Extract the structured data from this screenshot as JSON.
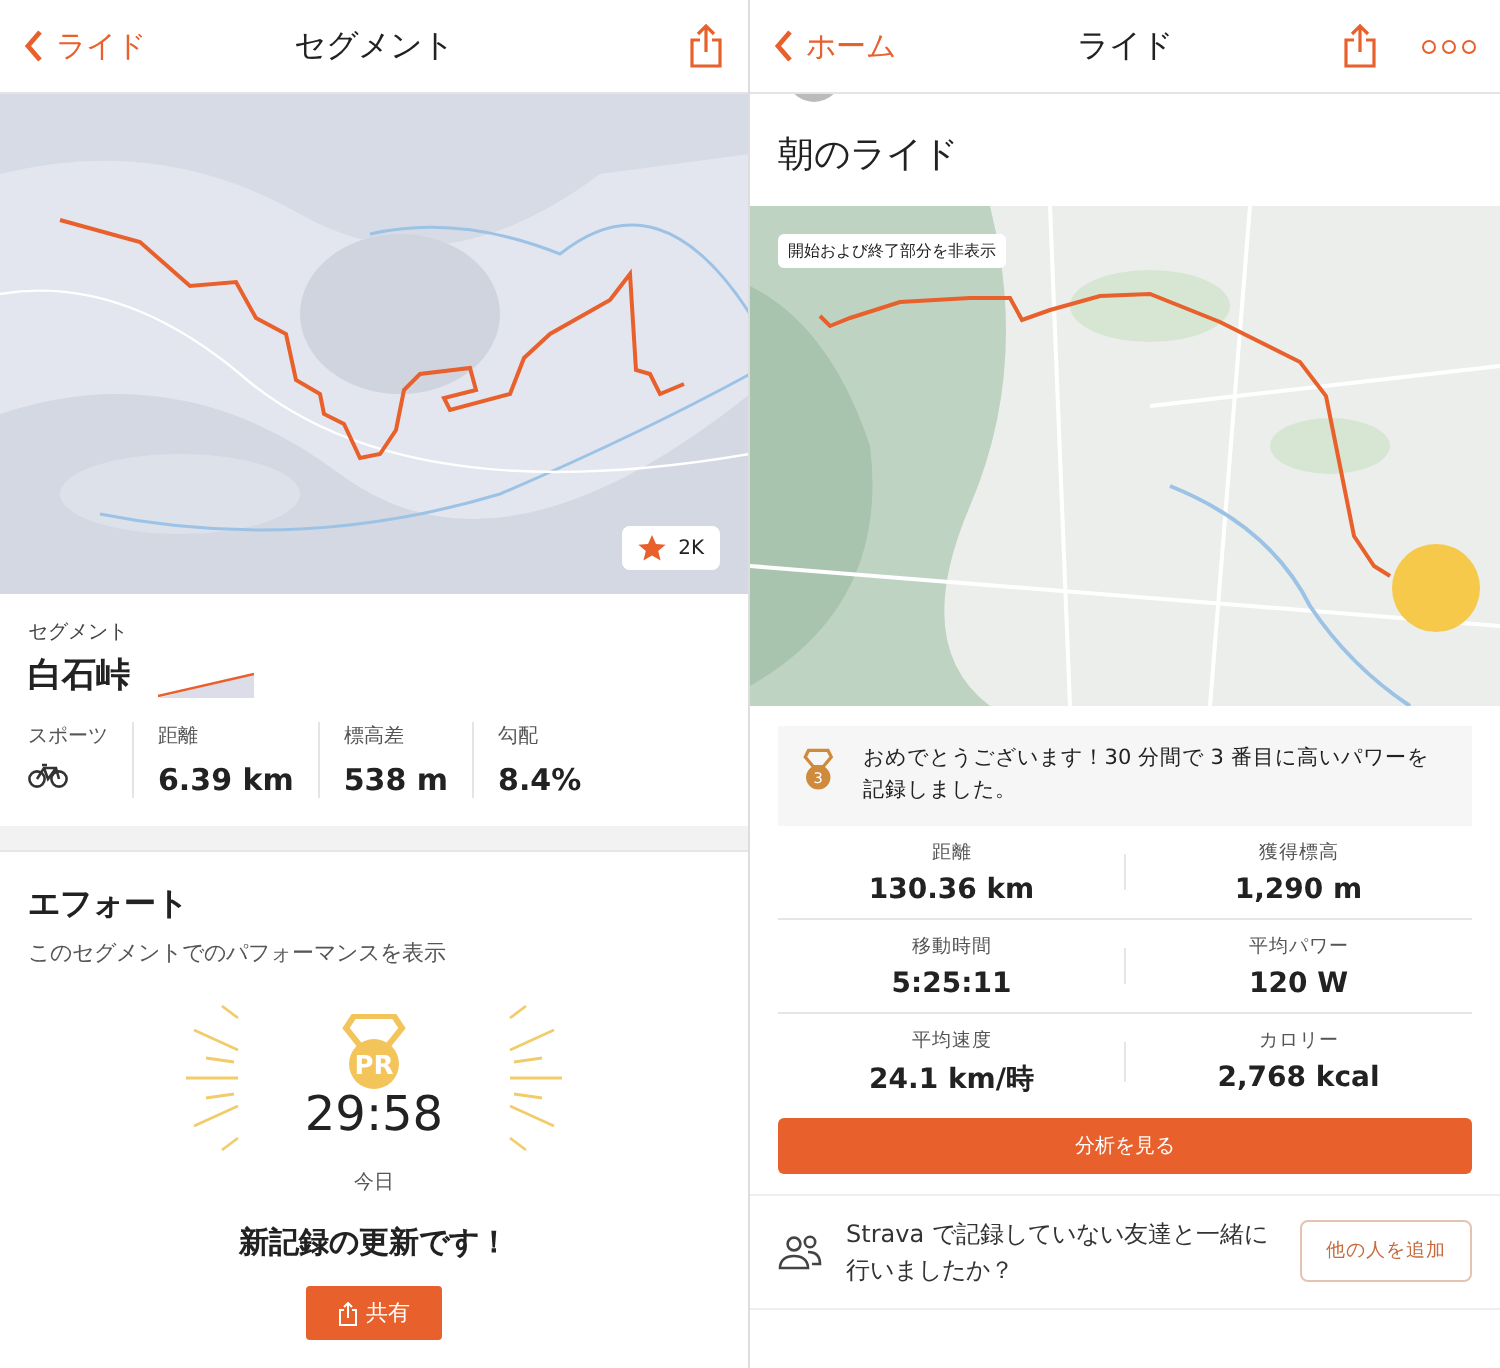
{
  "left": {
    "nav": {
      "back": "ライド",
      "title": "セグメント"
    },
    "map": {
      "kind": "picture",
      "badge": "2K"
    },
    "segment": {
      "label": "セグメント",
      "name": "白石峠"
    },
    "stats": [
      {
        "kind": "sport",
        "label": "スポーツ"
      },
      {
        "kind": "value",
        "label": "距離",
        "value": "6.39 km"
      },
      {
        "kind": "value",
        "label": "標高差",
        "value": "538 m"
      },
      {
        "kind": "value",
        "label": "勾配",
        "value": "8.4%"
      }
    ],
    "effort": {
      "title": "エフォート",
      "subtitle": "このセグメントでのパフォーマンスを表示",
      "medal": "PR",
      "time": "29:58",
      "date": "今日",
      "message": "新記録の更新です！",
      "share": "共有"
    }
  },
  "right": {
    "nav": {
      "back": "ホーム",
      "title": "ライド"
    },
    "title": "朝のライド",
    "map": {
      "kind": "picture",
      "notice": "開始および終了部分を非表示"
    },
    "achievement": {
      "rank": "3",
      "text": "おめでとうございます！30 分間で 3 番目に高いパワーを記録しました。"
    },
    "stats": [
      {
        "label": "距離",
        "value": "130.36 km"
      },
      {
        "label": "獲得標高",
        "value": "1,290 m"
      },
      {
        "label": "移動時間",
        "value": "5:25:11"
      },
      {
        "label": "平均パワー",
        "value": "120 W"
      },
      {
        "label": "平均速度",
        "value": "24.1 km/時"
      },
      {
        "label": "カロリー",
        "value": "2,768 kcal"
      }
    ],
    "analysis_button": "分析を見る",
    "friends": {
      "text": "Strava で記録していない友達と一緒に行いましたか？",
      "button": "他の人を追加"
    }
  }
}
